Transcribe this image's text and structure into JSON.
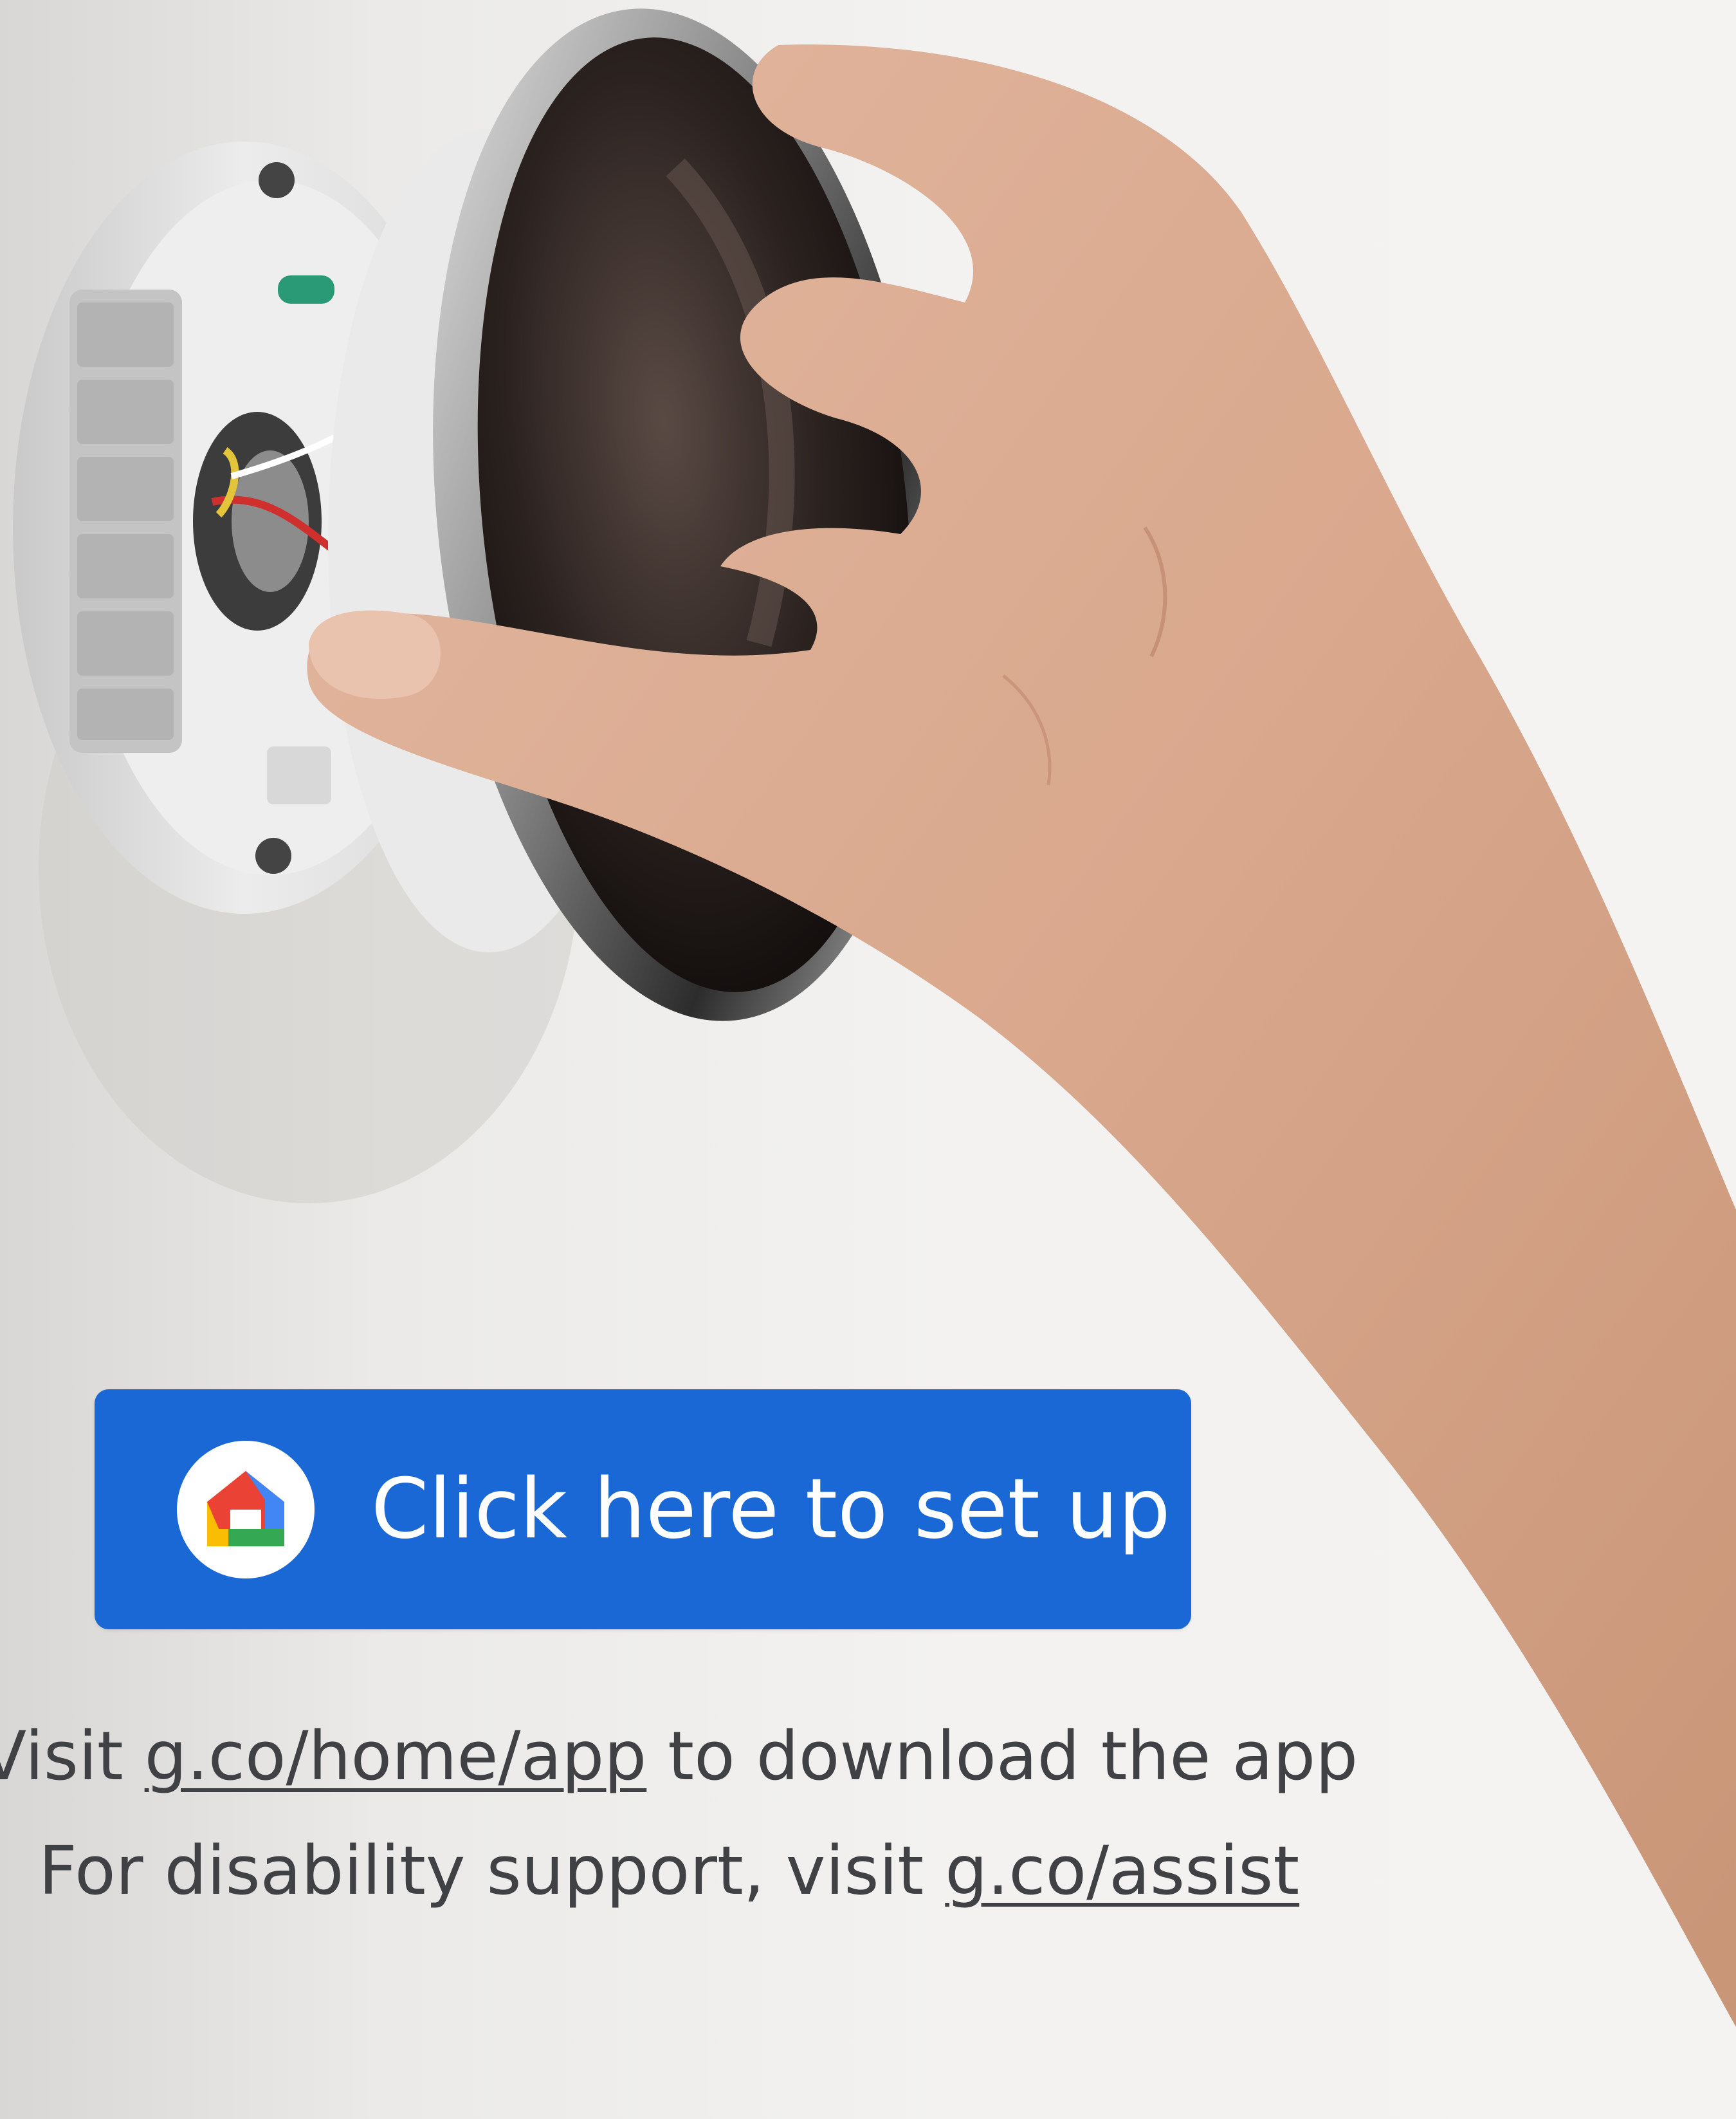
{
  "setup_button": {
    "label": "Click here to set up",
    "background_color": "#1a67d6",
    "icon": "google-home-icon"
  },
  "info": {
    "line1": {
      "prefix": "Visit ",
      "link": "g.co/home/app",
      "suffix": " to download the app"
    },
    "line2": {
      "prefix": "For disability support, visit ",
      "link": "g.co/assist"
    }
  },
  "colors": {
    "text": "#3f4145",
    "home_red": "#ea4335",
    "home_blue": "#4285f4",
    "home_yellow": "#fbbc04",
    "home_green": "#34a853"
  }
}
